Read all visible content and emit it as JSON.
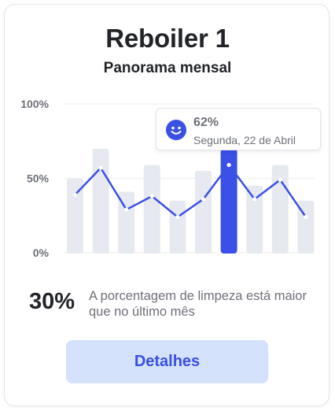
{
  "card": {
    "title": "Reboiler 1",
    "subtitle": "Panorama mensal"
  },
  "tooltip": {
    "value": "62%",
    "date": "Segunda, 22 de Abril",
    "icon": "smiley-face-icon"
  },
  "summary": {
    "value": "30%",
    "text": "A porcentagem de limpeza está maior que no último mês"
  },
  "actions": {
    "details_label": "Detalhes"
  },
  "colors": {
    "accent": "#3a50e6",
    "bar": "#e6e9ef",
    "button_bg": "#d5e2fb",
    "text_dark": "#222428",
    "text_muted": "#6e7178"
  },
  "chart_data": {
    "type": "bar",
    "y_ticks": [
      "100%",
      "50%",
      "0%"
    ],
    "ylim": [
      0,
      100
    ],
    "grid": true,
    "highlight_index": 6,
    "series": [
      {
        "kind": "bar",
        "values": [
          50,
          70,
          41,
          59,
          35,
          55,
          70,
          45,
          59,
          35
        ]
      },
      {
        "kind": "line",
        "values": [
          39,
          57,
          29,
          38,
          24,
          36,
          59,
          36,
          49,
          24
        ]
      }
    ]
  }
}
